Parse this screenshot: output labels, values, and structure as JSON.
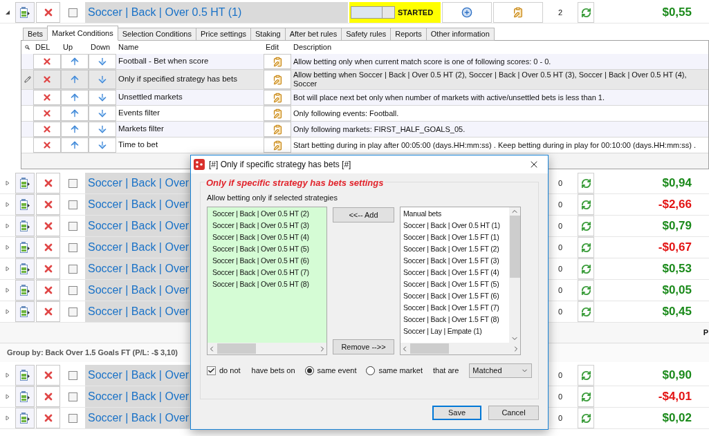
{
  "top_strategy": {
    "expanded": true,
    "checked": false,
    "name": "Soccer | Back | Over 0.5 HT (1)",
    "status": "STARTED",
    "count": "2",
    "pl": "$0,55",
    "color": "#1b8a1b"
  },
  "tabs": [
    {
      "label": "Bets",
      "selected": false
    },
    {
      "label": "Market Conditions",
      "selected": true
    },
    {
      "label": "Selection Conditions",
      "selected": false
    },
    {
      "label": "Price settings",
      "selected": false
    },
    {
      "label": "Staking",
      "selected": false
    },
    {
      "label": "After bet rules",
      "selected": false
    },
    {
      "label": "Safety rules",
      "selected": false
    },
    {
      "label": "Reports",
      "selected": false
    },
    {
      "label": "Other information",
      "selected": false
    }
  ],
  "conditions": {
    "columns": [
      "DEL",
      "Up",
      "Down",
      "Name",
      "Edit",
      "Description"
    ],
    "rows": [
      {
        "name": "Football - Bet when score",
        "description": "Allow betting only when current match score is one of following scores: 0 - 0.",
        "selected": false
      },
      {
        "name": "Only if specified strategy has bets",
        "description": "Allow betting when Soccer | Back | Over 0.5 HT (2), Soccer | Back | Over 0.5 HT (3), Soccer | Back | Over 0.5 HT (4), Soccer",
        "selected": true
      },
      {
        "name": "Unsettled markets",
        "description": "Bot will place next bet only when number of markets with active/unsettled bets is less than 1.",
        "selected": false
      },
      {
        "name": "Events filter",
        "description": "Only following events: Football.",
        "selected": false
      },
      {
        "name": "Markets filter",
        "description": "Only following markets: FIRST_HALF_GOALS_05.",
        "selected": false
      },
      {
        "name": "Time to bet",
        "description": "Start betting during in play after 00:05:00 (days.HH:mm:ss) . Keep betting during in play for 00:10:00 (days.HH:mm:ss) .",
        "selected": false
      }
    ]
  },
  "strategies": [
    {
      "expanded": false,
      "checked": false,
      "name": "Soccer | Back | Over",
      "count": "0",
      "pl": "$0,94",
      "color": "#1b8a1b"
    },
    {
      "expanded": false,
      "checked": false,
      "name": "Soccer | Back | Over",
      "count": "0",
      "pl": "-$2,66",
      "color": "#e31414"
    },
    {
      "expanded": false,
      "checked": false,
      "name": "Soccer | Back | Over",
      "count": "0",
      "pl": "$0,79",
      "color": "#1b8a1b"
    },
    {
      "expanded": false,
      "checked": false,
      "name": "Soccer | Back | Over",
      "count": "0",
      "pl": "-$0,67",
      "color": "#e31414"
    },
    {
      "expanded": false,
      "checked": false,
      "name": "Soccer | Back | Over",
      "count": "0",
      "pl": "$0,53",
      "color": "#1b8a1b"
    },
    {
      "expanded": false,
      "checked": false,
      "name": "Soccer | Back | Over",
      "count": "0",
      "pl": "$0,05",
      "color": "#1b8a1b"
    },
    {
      "expanded": false,
      "checked": false,
      "name": "Soccer | Back | Over",
      "count": "0",
      "pl": "$0,45",
      "color": "#1b8a1b"
    }
  ],
  "footer_text": "P",
  "group": {
    "title": "Group by: Back Over 1.5 Goals FT (P/L: -$ 3,10)",
    "strategies": [
      {
        "expanded": false,
        "checked": false,
        "name": "Soccer | Back | Over",
        "count": "0",
        "pl": "$0,90",
        "color": "#1b8a1b"
      },
      {
        "expanded": false,
        "checked": false,
        "name": "Soccer | Back | Over",
        "count": "0",
        "pl": "-$4,01",
        "color": "#e31414"
      },
      {
        "expanded": false,
        "checked": false,
        "name": "Soccer | Back | Over",
        "count": "0",
        "pl": "$0,02",
        "color": "#1b8a1b"
      }
    ]
  },
  "dialog": {
    "title": "[#] Only if specific strategy has bets [#]",
    "heading": "Only if specific strategy has bets settings",
    "subtitle": "Allow betting only if selected strategies",
    "selected_strategies": [
      "Soccer | Back | Over 0.5 HT (2)",
      "Soccer | Back | Over 0.5 HT (3)",
      "Soccer | Back | Over 0.5 HT (4)",
      "Soccer | Back | Over 0.5 HT (5)",
      "Soccer | Back | Over 0.5 HT (6)",
      "Soccer | Back | Over 0.5 HT (7)",
      "Soccer | Back | Over 0.5 HT (8)"
    ],
    "available_strategies": [
      "Manual bets",
      "Soccer | Back | Over 0.5 HT (1)",
      "Soccer | Back | Over 1.5 FT (1)",
      "Soccer | Back | Over 1.5 FT (2)",
      "Soccer | Back | Over 1.5 FT (3)",
      "Soccer | Back | Over 1.5 FT (4)",
      "Soccer | Back | Over 1.5 FT (5)",
      "Soccer | Back | Over 1.5 FT (6)",
      "Soccer | Back | Over 1.5 FT (7)",
      "Soccer | Back | Over 1.5 FT (8)",
      "Soccer | Lay | Empate (1)"
    ],
    "add_button": "<<-- Add",
    "remove_button": "Remove -->>",
    "do_not": {
      "label": "do not",
      "checked": true
    },
    "have_bets_label": "have bets on",
    "scope_options": [
      {
        "label": "same event",
        "selected": true
      },
      {
        "label": "same market",
        "selected": false
      }
    ],
    "that_are_label": "that are",
    "bet_state": "Matched",
    "buttons": [
      {
        "label": "Save",
        "default": true
      },
      {
        "label": "Cancel",
        "default": false
      }
    ]
  }
}
